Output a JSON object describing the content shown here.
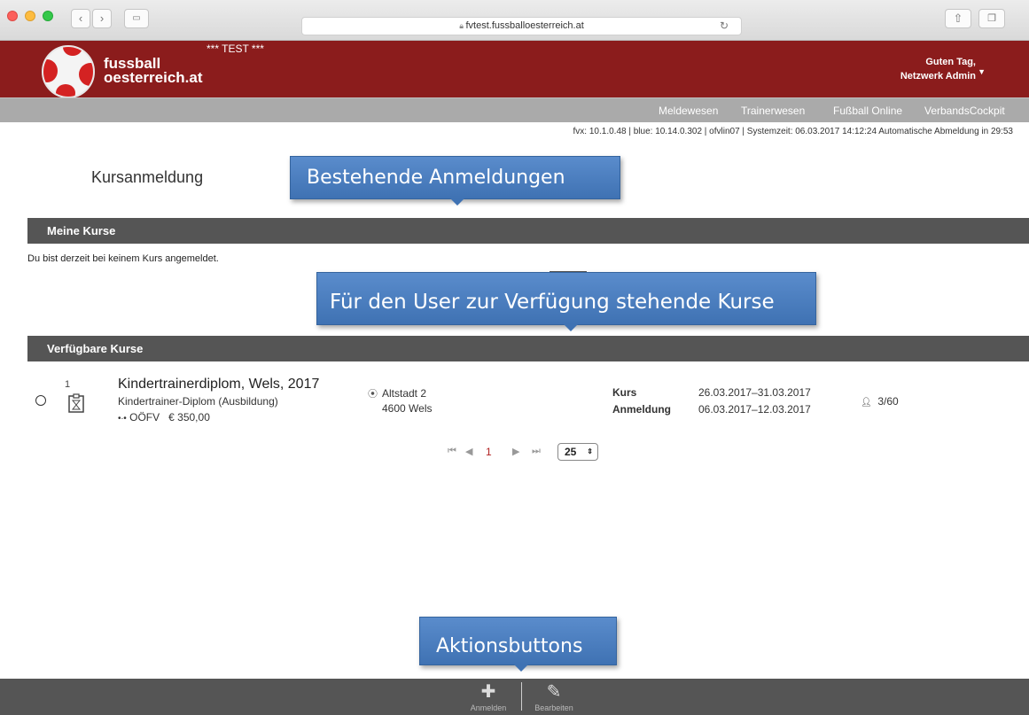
{
  "browser": {
    "url": "fvtest.fussballoesterreich.at",
    "reload_icon": "reload-icon"
  },
  "header": {
    "brand_line1": "fussball",
    "brand_line2": "oesterreich.at",
    "test_label": "*** TEST ***",
    "greeting": "Guten Tag,",
    "user_name": "Netzwerk Admin",
    "color": "#8b1c1c"
  },
  "nav": {
    "items": [
      "Meldewesen",
      "Trainerwesen",
      "Fußball Online",
      "VerbandsCockpit"
    ]
  },
  "sysinfo": "fvx: 10.1.0.48 | blue: 10.14.0.302 | ofvlin07 | Systemzeit:   06.03.2017 14:12:24   Automatische Abmeldung in 29:53",
  "page_title": "Kursanmeldung",
  "meine_kurse": {
    "heading": "Meine Kurse",
    "empty_text": "Du bist derzeit bei keinem Kurs angemeldet."
  },
  "verfuegbare_kurse": {
    "heading": "Verfügbare Kurse",
    "courses": [
      {
        "index": "1",
        "title": "Kindertrainerdiplom, Wels, 2017",
        "subtitle": "Kindertrainer-Diplom (Ausbildung)",
        "organisation": "OÖFV",
        "price": "€  350,00",
        "address_line1": "Altstadt 2",
        "address_line2": "4600 Wels",
        "kurs_label": "Kurs",
        "kurs_dates": "26.03.2017–31.03.2017",
        "anmeldung_label": "Anmeldung",
        "anmeldung_dates": "06.03.2017–12.03.2017",
        "capacity": "3/60"
      }
    ]
  },
  "pagination": {
    "current_page": "1",
    "page_size": "25"
  },
  "callouts": {
    "bestehende": "Bestehende Anmeldungen",
    "verfuegbar": "Für den User zur Verfügung stehende Kurse",
    "aktionen": "Aktionsbuttons",
    "color": "#4a7dbf"
  },
  "actions": {
    "anmelden": "Anmelden",
    "bearbeiten": "Bearbeiten"
  }
}
